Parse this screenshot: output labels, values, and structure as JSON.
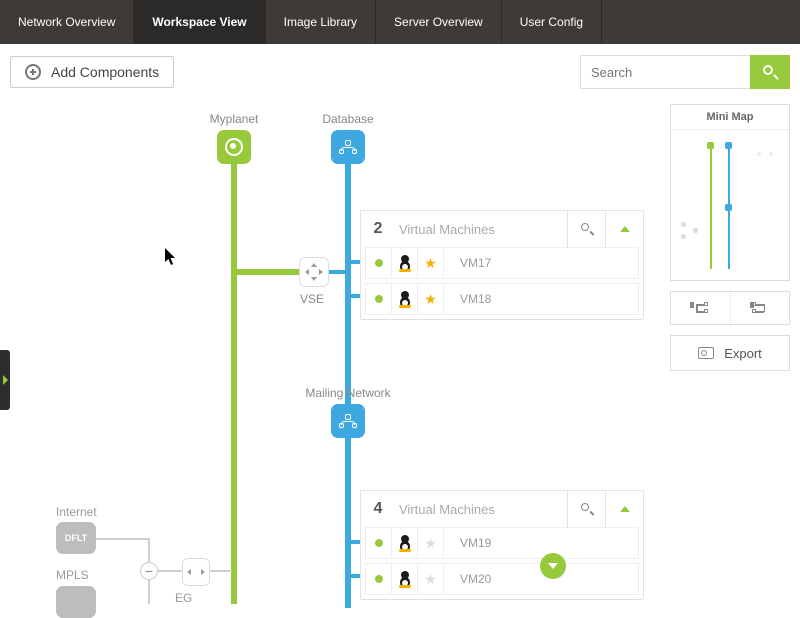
{
  "nav": {
    "tabs": [
      "Network Overview",
      "Workspace View",
      "Image Library",
      "Server Overview",
      "User Config"
    ],
    "active_index": 1
  },
  "toolbar": {
    "add_label": "Add Components",
    "search_placeholder": "Search"
  },
  "nodes": {
    "myplanet_label": "Myplanet",
    "database_label": "Database",
    "mailing_label": "Mailing Network",
    "vse_label": "VSE",
    "internet_label": "Internet",
    "dflt_label": "DFLT",
    "mpls_label": "MPLS",
    "eg_label": "EG"
  },
  "vm_groups": [
    {
      "count": "2",
      "title": "Virtual Machines",
      "rows": [
        {
          "name": "VM17",
          "star": true
        },
        {
          "name": "VM18",
          "star": true
        }
      ]
    },
    {
      "count": "4",
      "title": "Virtual Machines",
      "rows": [
        {
          "name": "VM19",
          "star": false
        },
        {
          "name": "VM20",
          "star": false
        }
      ]
    }
  ],
  "sidebar": {
    "minimap_title": "Mini Map",
    "export_label": "Export"
  },
  "colors": {
    "green": "#97c93d",
    "blue": "#3ea9e0",
    "gray": "#bdbdbd"
  }
}
